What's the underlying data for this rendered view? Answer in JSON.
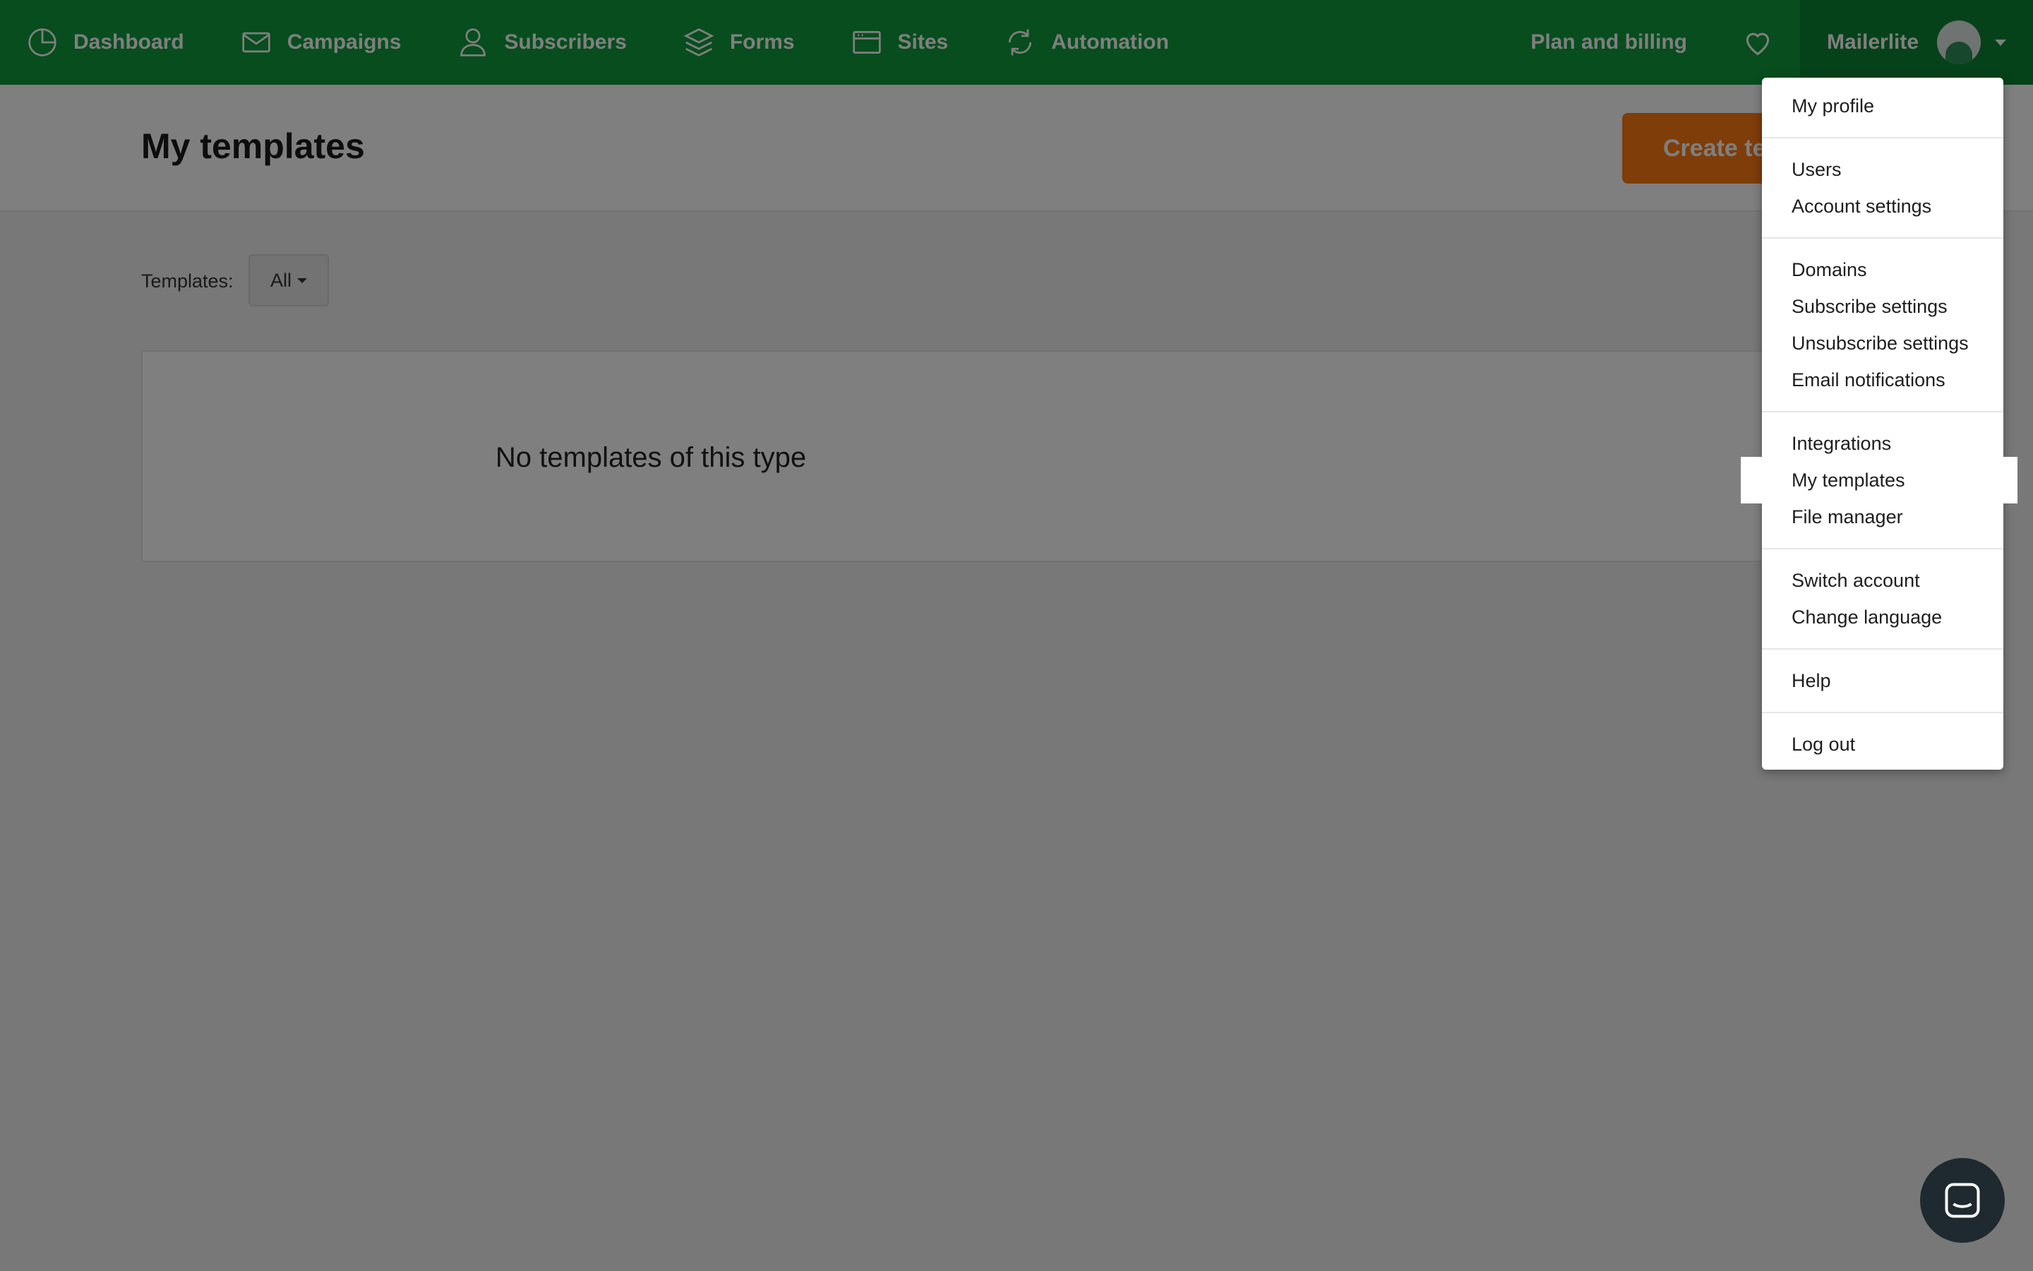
{
  "nav": {
    "items": [
      {
        "label": "Dashboard",
        "icon": "dashboard-icon"
      },
      {
        "label": "Campaigns",
        "icon": "envelope-icon"
      },
      {
        "label": "Subscribers",
        "icon": "user-icon"
      },
      {
        "label": "Forms",
        "icon": "layers-icon"
      },
      {
        "label": "Sites",
        "icon": "browser-window-icon"
      },
      {
        "label": "Automation",
        "icon": "refresh-icon"
      }
    ],
    "plan_label": "Plan and billing",
    "account_name": "Mailerlite",
    "brand_color": "#0f9b3c"
  },
  "page": {
    "title": "My templates",
    "create_button": "Create template",
    "filter_label": "Templates:",
    "filter_value": "All",
    "empty_message": "No templates of this type"
  },
  "account_menu": {
    "groups": [
      [
        "My profile"
      ],
      [
        "Users",
        "Account settings"
      ],
      [
        "Domains",
        "Subscribe settings",
        "Unsubscribe settings",
        "Email notifications"
      ],
      [
        "Integrations",
        "My templates",
        "File manager"
      ],
      [
        "Switch account",
        "Change language"
      ],
      [
        "Help"
      ],
      [
        "Log out"
      ]
    ],
    "highlighted": "My templates"
  },
  "colors": {
    "accent_orange": "#ff7a13",
    "chat_button": "#1f2a30"
  }
}
